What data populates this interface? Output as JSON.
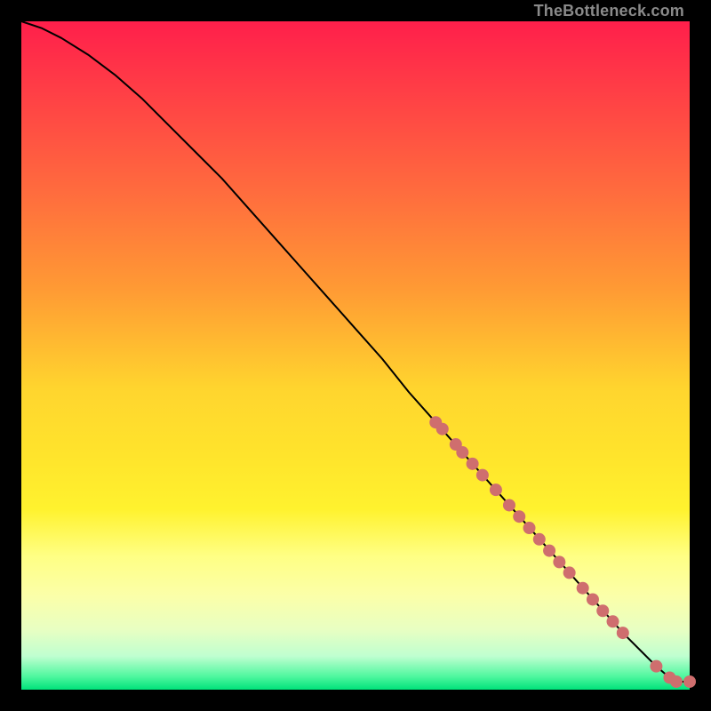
{
  "watermark": "TheBottleneck.com",
  "colors": {
    "curve_stroke": "#000000",
    "marker_fill": "#cf6e6e",
    "marker_stroke": "#b85a5a"
  },
  "chart_data": {
    "type": "line",
    "title": "",
    "xlabel": "",
    "ylabel": "",
    "xlim": [
      0,
      100
    ],
    "ylim": [
      0,
      100
    ],
    "grid": false,
    "legend": false,
    "series": [
      {
        "name": "bottleneck-curve",
        "x": [
          0,
          3,
          6,
          10,
          14,
          18,
          22,
          26,
          30,
          34,
          38,
          42,
          46,
          50,
          54,
          58,
          62,
          66,
          70,
          74,
          78,
          82,
          86,
          90,
          93,
          95,
          97,
          98,
          100
        ],
        "y": [
          100,
          99,
          97.5,
          95,
          92,
          88.5,
          84.5,
          80.5,
          76.5,
          72,
          67.5,
          63,
          58.5,
          54,
          49.5,
          44.5,
          40,
          35.5,
          31,
          26.5,
          22,
          17.5,
          13,
          8.5,
          5.5,
          3.5,
          1.8,
          1.2,
          1.2
        ]
      }
    ],
    "markers": {
      "name": "highlighted-points",
      "x": [
        62,
        63,
        65,
        66,
        67.5,
        69,
        71,
        73,
        74.5,
        76,
        77.5,
        79,
        80.5,
        82,
        84,
        85.5,
        87,
        88.5,
        90,
        95,
        97,
        98,
        100
      ],
      "y": [
        40,
        39,
        36.7,
        35.5,
        33.8,
        32.1,
        29.9,
        27.6,
        25.9,
        24.2,
        22.5,
        20.8,
        19.1,
        17.5,
        15.2,
        13.5,
        11.8,
        10.2,
        8.5,
        3.5,
        1.8,
        1.2,
        1.2
      ]
    }
  }
}
